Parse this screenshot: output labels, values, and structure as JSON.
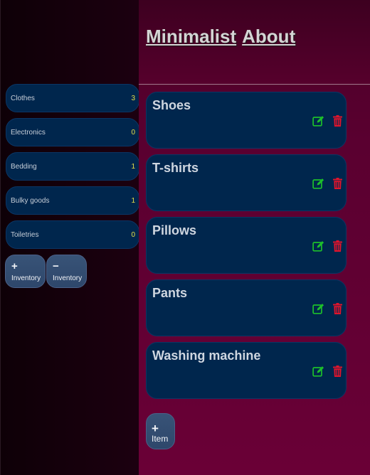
{
  "nav": {
    "links": [
      "Minimalist",
      "About"
    ]
  },
  "sidebar": {
    "inventories": [
      {
        "name": "Clothes",
        "count": "3"
      },
      {
        "name": "Electronics",
        "count": "0"
      },
      {
        "name": "Bedding",
        "count": "1"
      },
      {
        "name": "Bulky goods",
        "count": "1"
      },
      {
        "name": "Toiletries",
        "count": "0"
      }
    ],
    "add_inventory": {
      "symbol": "+",
      "label": "Inventory"
    },
    "remove_inventory": {
      "symbol": "−",
      "label": "Inventory"
    }
  },
  "main": {
    "items": [
      {
        "title": "Shoes"
      },
      {
        "title": "T-shirts"
      },
      {
        "title": "Pillows"
      },
      {
        "title": "Pants"
      },
      {
        "title": "Washing machine"
      }
    ],
    "add_item": {
      "symbol": "+",
      "label": "Item"
    }
  },
  "colors": {
    "edit": "#1dbf2b",
    "delete": "#e0142c",
    "card": "#00264d",
    "count": "#e8e04a"
  },
  "icons": {
    "edit": "edit-icon",
    "delete": "trash-icon"
  }
}
